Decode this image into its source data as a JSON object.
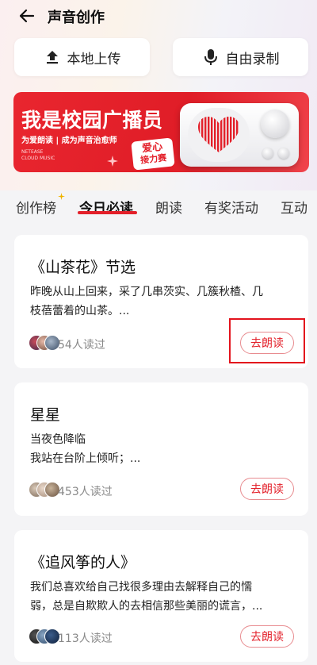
{
  "header": {
    "title": "声音创作"
  },
  "actions": {
    "upload_label": "本地上传",
    "record_label": "自由录制"
  },
  "banner": {
    "title": "我是校园广播员",
    "subtitle": "为爱朗读 | 成为声音治愈师",
    "brand_line1": "NETEASE",
    "brand_line2": "CLOUD MUSIC",
    "badge_line1": "爱心",
    "badge_line2": "接力赛"
  },
  "tabs": [
    {
      "label": "创作榜"
    },
    {
      "label": "今日必读"
    },
    {
      "label": "朗读"
    },
    {
      "label": "有奖活动"
    },
    {
      "label": "互动"
    }
  ],
  "cards": [
    {
      "title": "《山茶花》节选",
      "excerpt_line1": "昨晚从山上回来，采了几串茨实、几簇秋楂、几",
      "excerpt_line2": "枝蓓蕾着的山茶。...",
      "read_count": "54人读过",
      "button_label": "去朗读"
    },
    {
      "title": "星星",
      "excerpt_line1": "当夜色降临",
      "excerpt_line2": "我站在台阶上倾听；...",
      "read_count": "453人读过",
      "button_label": "去朗读"
    },
    {
      "title": "《追风筝的人》",
      "excerpt_line1": "我们总喜欢给自己找很多理由去解释自己的懦",
      "excerpt_line2": "弱，总是自欺欺人的去相信那些美丽的谎言，...",
      "read_count": "113人读过",
      "button_label": "去朗读"
    }
  ],
  "colors": {
    "accent": "#e3202a",
    "banner_red": "#e01d27",
    "muted_text": "#888888"
  },
  "icons": {
    "back": "arrow-left-icon",
    "upload": "upload-arrow-icon",
    "record": "microphone-icon"
  }
}
